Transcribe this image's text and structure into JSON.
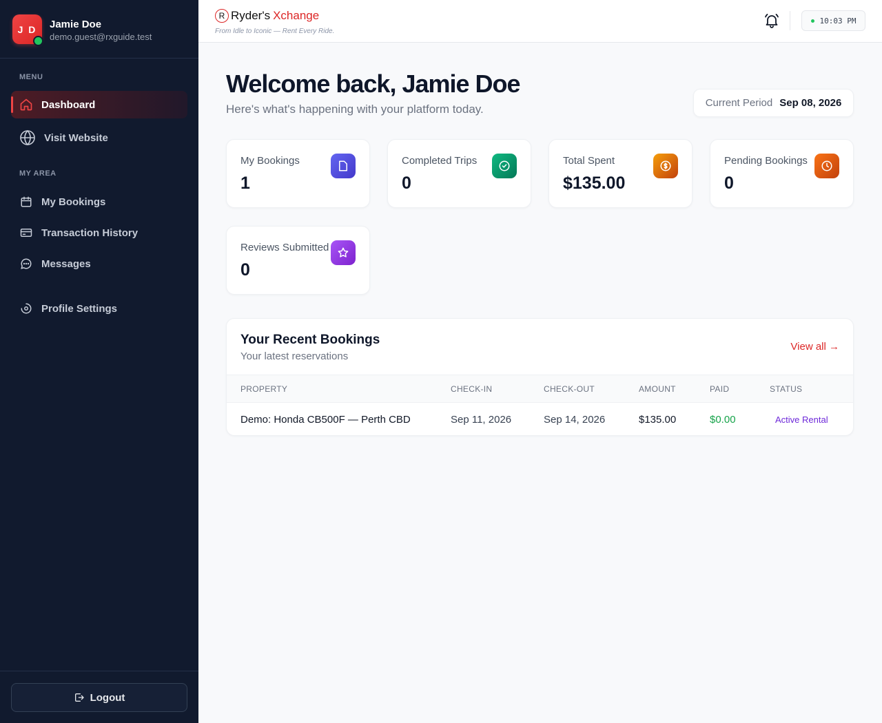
{
  "user": {
    "initials": "J D",
    "name": "Jamie Doe",
    "email": "demo.guest@rxguide.test"
  },
  "sidebar": {
    "menu_label": "MENU",
    "my_area_label": "MY AREA",
    "items": [
      {
        "label": "Dashboard",
        "icon": "home-icon",
        "active": true
      },
      {
        "label": "Visit Website",
        "icon": "globe-icon"
      },
      {
        "label": "My Bookings",
        "icon": "calendar-icon"
      },
      {
        "label": "Transaction History",
        "icon": "credit-card-icon"
      },
      {
        "label": "Messages",
        "icon": "chat-icon"
      },
      {
        "label": "Profile Settings",
        "icon": "settings-icon"
      }
    ],
    "logout_label": "Logout"
  },
  "header": {
    "brand_mark": "R",
    "brand_a": "Ryder's",
    "brand_b": "Xchange",
    "tagline": "From Idle to Iconic — Rent Every Ride.",
    "clock": "10:03 PM"
  },
  "main": {
    "welcome": "Welcome back, Jamie Doe",
    "subtitle": "Here's what's happening with your platform today.",
    "period_label": "Current Period",
    "period_value": "Sep 08, 2026"
  },
  "stats": [
    {
      "label": "My Bookings",
      "value": "1",
      "icon": "file-icon",
      "color": "#4f46e5"
    },
    {
      "label": "Completed Trips",
      "value": "0",
      "icon": "check-circle-icon",
      "color": "#059669"
    },
    {
      "label": "Total Spent",
      "value": "$135.00",
      "icon": "dollar-icon",
      "color": "#d97706"
    },
    {
      "label": "Pending Bookings",
      "value": "0",
      "icon": "clock-icon",
      "color": "#ea580c"
    },
    {
      "label": "Reviews Submitted",
      "value": "0",
      "icon": "star-icon",
      "color": "#9333ea"
    }
  ],
  "bookings": {
    "title": "Your Recent Bookings",
    "subtitle": "Your latest reservations",
    "view_all": "View all →",
    "columns": [
      "PROPERTY",
      "CHECK-IN",
      "CHECK-OUT",
      "AMOUNT",
      "PAID",
      "STATUS"
    ],
    "rows": [
      {
        "property": "Demo: Honda CB500F — Perth CBD",
        "check_in": "Sep 11, 2026",
        "check_out": "Sep 14, 2026",
        "amount": "$135.00",
        "paid": "$0.00",
        "status": "Active Rental"
      }
    ]
  },
  "colors": {
    "sidebar_bg": "#111a2e",
    "accent": "#dc2626",
    "paid_green": "#16a34a",
    "status_purple": "#6d28d9"
  }
}
